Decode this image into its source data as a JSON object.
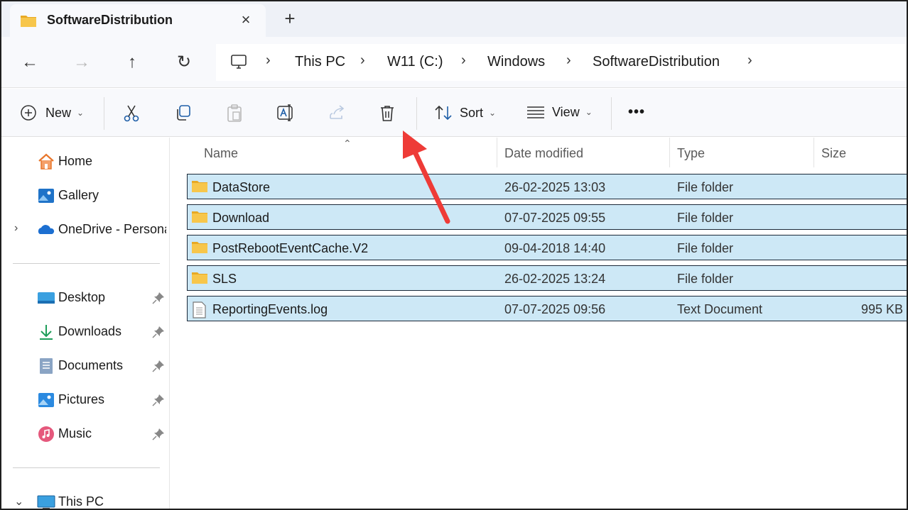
{
  "tab": {
    "title": "SoftwareDistribution",
    "close_icon": "×",
    "new_tab_icon": "+"
  },
  "nav": {
    "back": "←",
    "forward": "→",
    "up": "↑",
    "refresh": "↻"
  },
  "breadcrumb": {
    "sep": "›",
    "items": [
      "This PC",
      "W11 (C:)",
      "Windows",
      "SoftwareDistribution"
    ]
  },
  "toolbar": {
    "new_label": "New",
    "sort_label": "Sort",
    "view_label": "View",
    "more_label": "•••",
    "chev": "⌄"
  },
  "sidebar": {
    "expand_icon": "›",
    "collapse_icon": "⌄",
    "top": [
      {
        "label": "Home",
        "icon": "home-icon"
      },
      {
        "label": "Gallery",
        "icon": "gallery-icon"
      },
      {
        "label": "OneDrive - Personal",
        "icon": "onedrive-icon"
      }
    ],
    "quick": [
      {
        "label": "Desktop",
        "icon": "desktop-icon"
      },
      {
        "label": "Downloads",
        "icon": "downloads-icon"
      },
      {
        "label": "Documents",
        "icon": "documents-icon"
      },
      {
        "label": "Pictures",
        "icon": "pictures-icon"
      },
      {
        "label": "Music",
        "icon": "music-icon"
      }
    ],
    "this_pc": "This PC"
  },
  "columns": {
    "name": "Name",
    "date": "Date modified",
    "type": "Type",
    "size": "Size",
    "sort_caret": "⌃"
  },
  "files": [
    {
      "name": "DataStore",
      "date": "26-02-2025 13:03",
      "type": "File folder",
      "size": "",
      "kind": "folder"
    },
    {
      "name": "Download",
      "date": "07-07-2025 09:55",
      "type": "File folder",
      "size": "",
      "kind": "folder"
    },
    {
      "name": "PostRebootEventCache.V2",
      "date": "09-04-2018 14:40",
      "type": "File folder",
      "size": "",
      "kind": "folder"
    },
    {
      "name": "SLS",
      "date": "26-02-2025 13:24",
      "type": "File folder",
      "size": "",
      "kind": "folder"
    },
    {
      "name": "ReportingEvents.log",
      "date": "07-07-2025 09:56",
      "type": "Text Document",
      "size": "995 KB",
      "kind": "file"
    }
  ],
  "colors": {
    "selection": "#cde8f6",
    "folder": "#f7c64b",
    "annotation_arrow": "#ee3b37",
    "accent": "#0067c0"
  }
}
